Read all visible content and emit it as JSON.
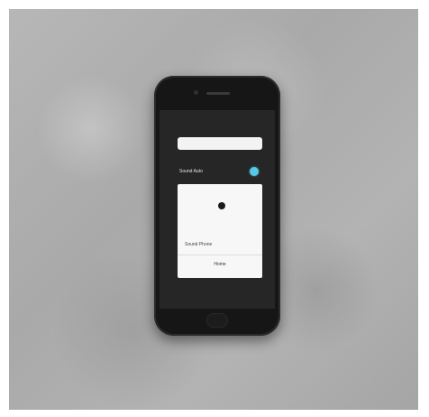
{
  "status_bar": {
    "left_text": "",
    "time": "",
    "right_text": ""
  },
  "search": {
    "placeholder": ""
  },
  "toggle": {
    "label": "Sound Auto",
    "state": "on",
    "accent_color": "#56c8e6"
  },
  "card": {
    "title": "Sound Phone",
    "button_label": "Home"
  },
  "icons": [
    "camera-icon",
    "speaker-icon",
    "dot-icon",
    "home-button-icon"
  ]
}
